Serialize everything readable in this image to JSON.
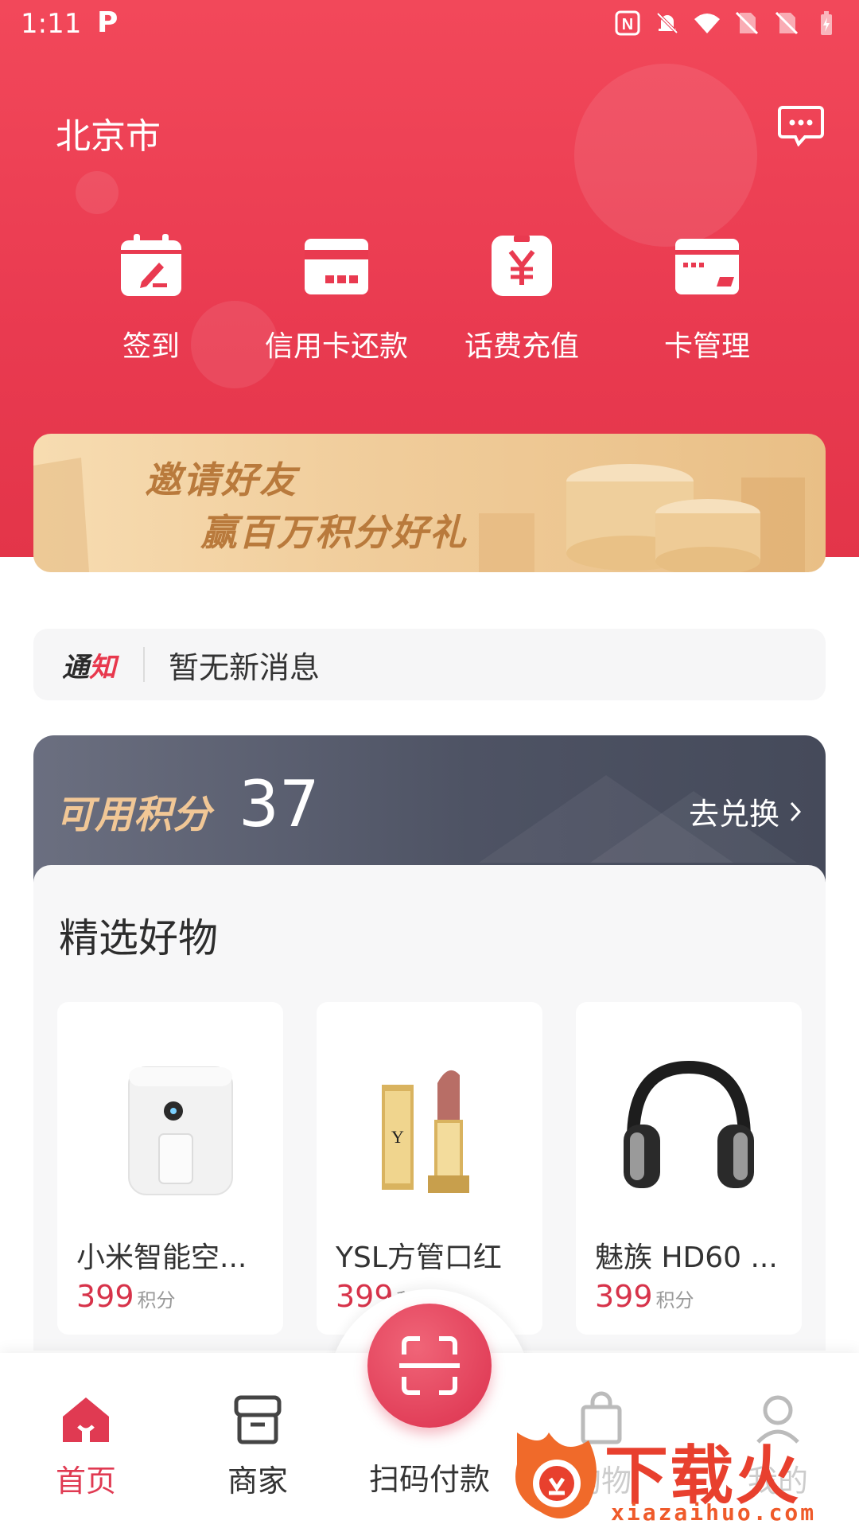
{
  "status_bar": {
    "time": "1:11",
    "app_glyph": "P"
  },
  "header": {
    "city": "北京市",
    "message_icon": "chat-bubble-icon"
  },
  "quick_actions": [
    {
      "label": "签到",
      "icon": "calendar-checkin-icon"
    },
    {
      "label": "信用卡还款",
      "icon": "credit-card-icon"
    },
    {
      "label": "话费充值",
      "icon": "phone-topup-yuan-icon"
    },
    {
      "label": "卡管理",
      "icon": "card-management-icon"
    }
  ],
  "banner": {
    "line1": "邀请好友",
    "line2": "赢百万积分好礼"
  },
  "notice": {
    "tag_a": "通",
    "tag_b": "知",
    "text": "暂无新消息"
  },
  "points": {
    "label": "可用积分",
    "value": "37",
    "exchange": "去兑换"
  },
  "featured": {
    "title": "精选好物",
    "items": [
      {
        "name": "小米智能空...",
        "price": "399",
        "unit": "积分",
        "image": "air-fryer"
      },
      {
        "name": "YSL方管口红",
        "price": "399",
        "unit": "积分",
        "image": "lipstick"
      },
      {
        "name": "魅族 HD60 ...",
        "price": "399",
        "unit": "积分",
        "image": "headphones"
      }
    ]
  },
  "nav": {
    "home": "首页",
    "merchant": "商家",
    "scan": "扫码付款",
    "shop": "购物",
    "mine": "我的"
  },
  "watermark": {
    "text": "下载火",
    "sub": "xiazaihuo.com"
  },
  "colors": {
    "brand_red": "#e93a50",
    "price_red": "#d7334a",
    "gold": "#f1c796",
    "card_dark": "#4e5364"
  }
}
